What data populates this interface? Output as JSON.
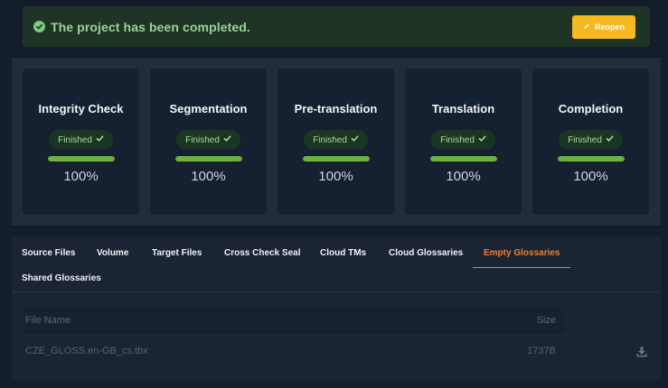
{
  "banner": {
    "message": "The project has been completed.",
    "reopen_label": "Reopen",
    "icon": "check-circle-icon",
    "reopen_icon": "pencil-icon"
  },
  "steps": [
    {
      "title": "Integrity Check",
      "status": "Finished",
      "percent_label": "100%",
      "progress": 1.0
    },
    {
      "title": "Segmentation",
      "status": "Finished",
      "percent_label": "100%",
      "progress": 1.0
    },
    {
      "title": "Pre-translation",
      "status": "Finished",
      "percent_label": "100%",
      "progress": 1.0
    },
    {
      "title": "Translation",
      "status": "Finished",
      "percent_label": "100%",
      "progress": 1.0
    },
    {
      "title": "Completion",
      "status": "Finished",
      "percent_label": "100%",
      "progress": 1.0
    }
  ],
  "tabs": [
    {
      "label": "Source Files"
    },
    {
      "label": "Volume"
    },
    {
      "label": "Target Files"
    },
    {
      "label": "Cross Check Seal"
    },
    {
      "label": "Cloud TMs"
    },
    {
      "label": "Cloud Glossaries"
    },
    {
      "label": "Empty Glossaries",
      "active": true
    },
    {
      "label": "Shared Glossaries"
    }
  ],
  "table": {
    "headers": {
      "name": "File Name",
      "size": "Size"
    },
    "rows": [
      {
        "name": "CZE_GLOSS.en-GB_cs.tbx",
        "size": "1737B",
        "action_icon": "download-icon"
      }
    ]
  },
  "colors": {
    "accent": "#f47c2a",
    "success": "#6db33f",
    "warning_button": "#f5b921"
  }
}
